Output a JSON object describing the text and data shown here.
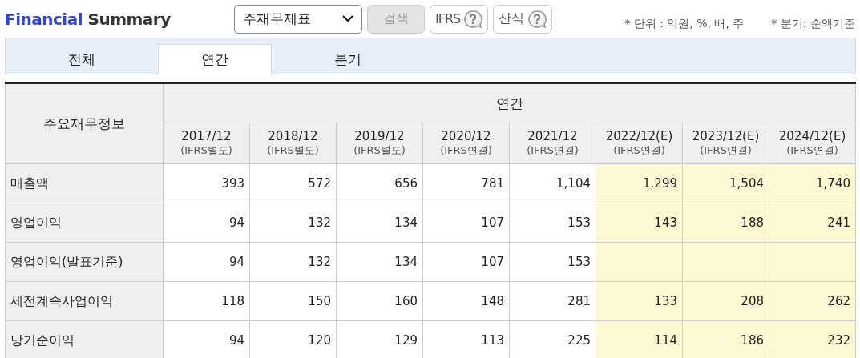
{
  "title": {
    "part_1": "Financial",
    "part_2": "Summary"
  },
  "toolbar": {
    "select": "주재무제표",
    "search_button": "검색",
    "ifrs_button": "IFRS",
    "formula_button": "산식",
    "notes": [
      "* 단위 : 억원, %, 배, 주",
      "* 분기: 순액기준"
    ]
  },
  "tabs": [
    {
      "label": "전체",
      "selected": false
    },
    {
      "label": "연간",
      "selected": true
    },
    {
      "label": "분기",
      "selected": false
    }
  ],
  "table": {
    "corner": "주요재무정보",
    "group": "연간",
    "columns": [
      {
        "period": "2017/12",
        "basis": "(IFRS별도)",
        "estimate": false
      },
      {
        "period": "2018/12",
        "basis": "(IFRS별도)",
        "estimate": false
      },
      {
        "period": "2019/12",
        "basis": "(IFRS별도)",
        "estimate": false
      },
      {
        "period": "2020/12",
        "basis": "(IFRS연결)",
        "estimate": false
      },
      {
        "period": "2021/12",
        "basis": "(IFRS연결)",
        "estimate": false
      },
      {
        "period": "2022/12(E)",
        "basis": "(IFRS연결)",
        "estimate": true
      },
      {
        "period": "2023/12(E)",
        "basis": "(IFRS연결)",
        "estimate": true
      },
      {
        "period": "2024/12(E)",
        "basis": "(IFRS연결)",
        "estimate": true
      }
    ],
    "rows": [
      {
        "label": "매출액",
        "values": [
          "393",
          "572",
          "656",
          "781",
          "1,104",
          "1,299",
          "1,504",
          "1,740"
        ]
      },
      {
        "label": "영업이익",
        "values": [
          "94",
          "132",
          "134",
          "107",
          "153",
          "143",
          "188",
          "241"
        ]
      },
      {
        "label": "영업이익(발표기준)",
        "values": [
          "94",
          "132",
          "134",
          "107",
          "153"
        ]
      },
      {
        "label": "세전계속사업이익",
        "values": [
          "118",
          "150",
          "160",
          "148",
          "281",
          "133",
          "208",
          "262"
        ]
      },
      {
        "label": "당기순이익",
        "values": [
          "94",
          "120",
          "129",
          "113",
          "225",
          "114",
          "186",
          "232"
        ]
      }
    ]
  }
}
